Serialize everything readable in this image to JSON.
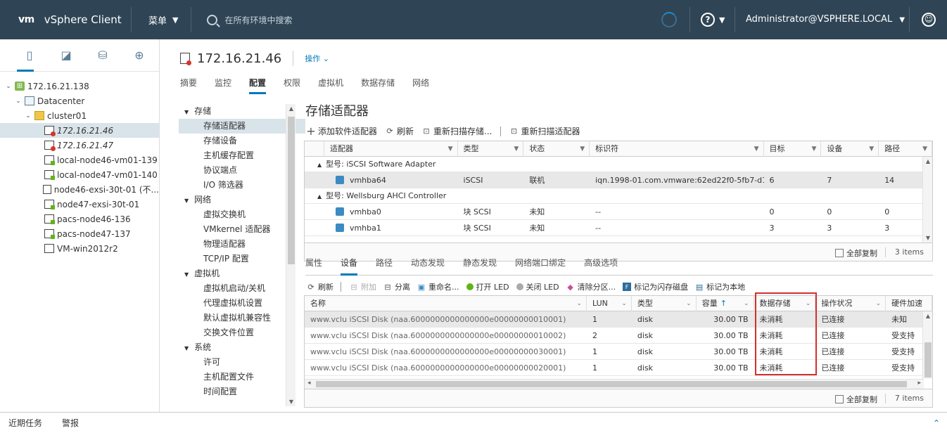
{
  "header": {
    "logo": "vm",
    "app_title": "vSphere Client",
    "menu_label": "菜单",
    "search_placeholder": "在所有环境中搜索",
    "help_label": "?",
    "user": "Administrator@VSPHERE.LOCAL"
  },
  "nav_tree": [
    {
      "label": "172.16.21.138",
      "level": 0,
      "icon": "vcenter-icon",
      "twisty": "v"
    },
    {
      "label": "Datacenter",
      "level": 1,
      "icon": "datacenter-icon",
      "twisty": "v"
    },
    {
      "label": "cluster01",
      "level": 2,
      "icon": "cluster-icon",
      "twisty": "v"
    },
    {
      "label": "172.16.21.46",
      "level": 3,
      "icon": "host-alert-icon",
      "selected": true,
      "italic": true
    },
    {
      "label": "172.16.21.47",
      "level": 3,
      "icon": "host-alert-icon",
      "italic": true
    },
    {
      "label": "local-node46-vm01-139",
      "level": 3,
      "icon": "vm-on-icon"
    },
    {
      "label": "local-node47-vm01-140",
      "level": 3,
      "icon": "vm-on-icon"
    },
    {
      "label": "node46-exsi-30t-01 (不...",
      "level": 3,
      "icon": "vm-off-icon"
    },
    {
      "label": "node47-exsi-30t-01",
      "level": 3,
      "icon": "vm-on-icon"
    },
    {
      "label": "pacs-node46-136",
      "level": 3,
      "icon": "vm-on-icon"
    },
    {
      "label": "pacs-node47-137",
      "level": 3,
      "icon": "vm-on-icon"
    },
    {
      "label": "VM-win2012r2",
      "level": 3,
      "icon": "vm-off-icon"
    }
  ],
  "object": {
    "name": "172.16.21.46",
    "actions": "操作"
  },
  "tabs": [
    "摘要",
    "监控",
    "配置",
    "权限",
    "虚拟机",
    "数据存储",
    "网络"
  ],
  "active_tab": "配置",
  "settings": [
    {
      "type": "group",
      "label": "存储"
    },
    {
      "type": "item",
      "label": "存储适配器",
      "selected": true
    },
    {
      "type": "item",
      "label": "存储设备"
    },
    {
      "type": "item",
      "label": "主机缓存配置"
    },
    {
      "type": "item",
      "label": "协议端点"
    },
    {
      "type": "item",
      "label": "I/O 筛选器"
    },
    {
      "type": "group",
      "label": "网络"
    },
    {
      "type": "item",
      "label": "虚拟交换机"
    },
    {
      "type": "item",
      "label": "VMkernel 适配器"
    },
    {
      "type": "item",
      "label": "物理适配器"
    },
    {
      "type": "item",
      "label": "TCP/IP 配置"
    },
    {
      "type": "group",
      "label": "虚拟机"
    },
    {
      "type": "item",
      "label": "虚拟机启动/关机"
    },
    {
      "type": "item",
      "label": "代理虚拟机设置"
    },
    {
      "type": "item",
      "label": "默认虚拟机兼容性"
    },
    {
      "type": "item",
      "label": "交换文件位置"
    },
    {
      "type": "group",
      "label": "系统"
    },
    {
      "type": "item",
      "label": "许可"
    },
    {
      "type": "item",
      "label": "主机配置文件"
    },
    {
      "type": "item",
      "label": "时间配置"
    }
  ],
  "adapters_panel": {
    "title": "存储适配器",
    "toolbar": {
      "add": "添加软件适配器",
      "refresh": "刷新",
      "rescan_storage": "重新扫描存储...",
      "rescan_adapter": "重新扫描适配器"
    },
    "columns": [
      "适配器",
      "类型",
      "状态",
      "标识符",
      "目标",
      "设备",
      "路径"
    ],
    "groups": [
      {
        "label": "型号: iSCSI Software Adapter",
        "rows": [
          {
            "adapter": "vmhba64",
            "type": "iSCSI",
            "status": "联机",
            "identifier": "iqn.1998-01.com.vmware:62ed22f0-5fb7-d1...",
            "targets": "6",
            "devices": "7",
            "paths": "14",
            "selected": true
          }
        ]
      },
      {
        "label": "型号: Wellsburg AHCI Controller",
        "rows": [
          {
            "adapter": "vmhba0",
            "type": "块 SCSI",
            "status": "未知",
            "identifier": "--",
            "targets": "0",
            "devices": "0",
            "paths": "0"
          },
          {
            "adapter": "vmhba1",
            "type": "块 SCSI",
            "status": "未知",
            "identifier": "--",
            "targets": "3",
            "devices": "3",
            "paths": "3"
          }
        ]
      }
    ],
    "copy_all": "全部复制",
    "count": "3 items"
  },
  "subtabs": [
    "属性",
    "设备",
    "路径",
    "动态发现",
    "静态发现",
    "网络端口绑定",
    "高级选项"
  ],
  "active_subtab": "设备",
  "devices_panel": {
    "toolbar": {
      "refresh": "刷新",
      "attach": "附加",
      "detach": "分离",
      "rename": "重命名...",
      "led_on": "打开 LED",
      "led_off": "关闭 LED",
      "clear_partitions": "清除分区...",
      "mark_flash": "标记为闪存磁盘",
      "mark_local": "标记为本地"
    },
    "columns": [
      "名称",
      "LUN",
      "类型",
      "容量",
      "数据存储",
      "操作状况",
      "硬件加速"
    ],
    "sort_indicator": "↑",
    "rows": [
      {
        "name": "www.vclu iSCSI Disk (naa.6000000000000000e00000000010001)",
        "lun": "1",
        "type": "disk",
        "capacity": "30.00 TB",
        "datastore": "未消耗",
        "status": "已连接",
        "hw": "未知",
        "selected": true
      },
      {
        "name": "www.vclu iSCSI Disk (naa.6000000000000000e00000000010002)",
        "lun": "2",
        "type": "disk",
        "capacity": "30.00 TB",
        "datastore": "未消耗",
        "status": "已连接",
        "hw": "受支持"
      },
      {
        "name": "www.vclu iSCSI Disk (naa.6000000000000000e00000000030001)",
        "lun": "1",
        "type": "disk",
        "capacity": "30.00 TB",
        "datastore": "未消耗",
        "status": "已连接",
        "hw": "受支持"
      },
      {
        "name": "www.vclu iSCSI Disk (naa.6000000000000000e00000000020001)",
        "lun": "1",
        "type": "disk",
        "capacity": "30.00 TB",
        "datastore": "未消耗",
        "status": "已连接",
        "hw": "受支持"
      }
    ],
    "copy_all": "全部复制",
    "count": "7 items"
  },
  "bottombar": {
    "recent_tasks": "近期任务",
    "alarms": "警报"
  },
  "colors": {
    "header_bg": "#2f4555",
    "accent": "#0079b8",
    "highlight": "#d32f2f"
  }
}
